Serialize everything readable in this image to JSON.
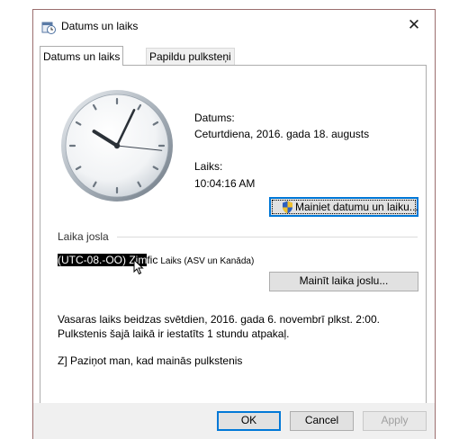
{
  "window": {
    "title": "Datums un laiks",
    "close_glyph": "✕"
  },
  "tabs": [
    {
      "label": "Datums un laiks",
      "active": true
    },
    {
      "label": "Papildu pulksteņi",
      "active": false
    }
  ],
  "clock": {
    "hours": 10,
    "minutes": 4,
    "seconds": 16
  },
  "date_section": {
    "date_label": "Datums:",
    "date_value": "Ceturtdiena, 2016. gada 18. augusts",
    "time_label": "Laiks:",
    "time_value": "10:04:16 AM",
    "change_button": "Mainiet datumu un laiku..."
  },
  "timezone_section": {
    "header": "Laika josla",
    "tz_selected": "(UTC-08.-OO) Zim",
    "tz_rest": "fic",
    "tz_small": "Laiks (ASV un Kanāda)",
    "change_button": "Mainīt laika joslu..."
  },
  "dst": {
    "line1": "Vasaras laiks beidzas svētdien, 2016. gada 6. novembrī plkst. 2:00.",
    "line2": "Pulkstenis šajā laikā ir iestatīts 1 stundu atpakaļ."
  },
  "notify_text": "Z] Paziņot man, kad mainās pulkstenis",
  "footer": {
    "ok": "OK",
    "cancel": "Cancel",
    "apply": "Apply"
  },
  "icons": {
    "app": "date-time-icon",
    "shield": "uac-shield-icon",
    "cursor": "mouse-pointer-icon"
  }
}
